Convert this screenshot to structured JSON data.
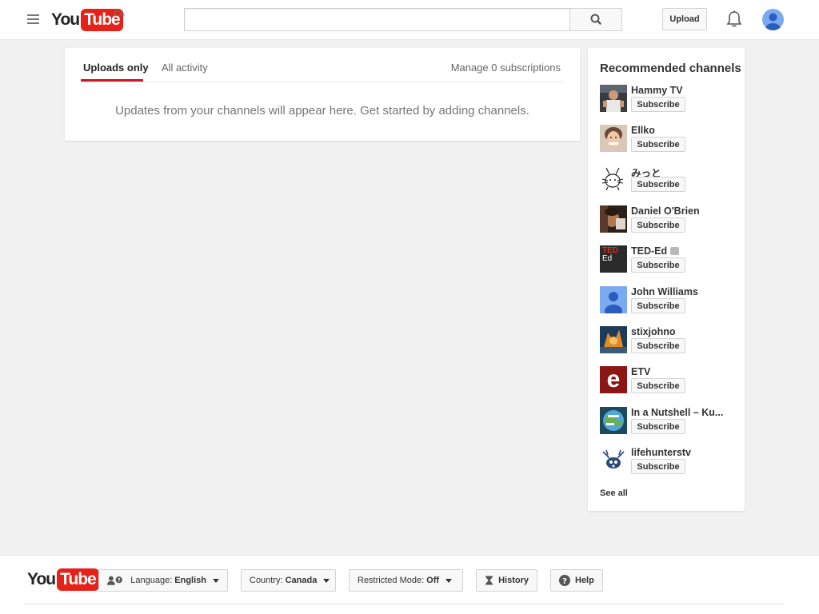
{
  "header": {
    "logo_you": "You",
    "logo_tube": "Tube",
    "country_code": "CA",
    "search_placeholder": "",
    "upload_label": "Upload"
  },
  "feed": {
    "tabs": [
      {
        "label": "Uploads only",
        "active": true
      },
      {
        "label": "All activity",
        "active": false
      }
    ],
    "manage_label": "Manage 0 subscriptions",
    "empty_message": "Updates from your channels will appear here. Get started by adding channels."
  },
  "recommended": {
    "title": "Recommended channels",
    "subscribe_label": "Subscribe",
    "see_all_label": "See all",
    "channels": [
      {
        "name": "Hammy TV",
        "verified": false
      },
      {
        "name": "Ellko",
        "verified": false
      },
      {
        "name": "みっと",
        "verified": false
      },
      {
        "name": "Daniel O'Brien",
        "verified": false
      },
      {
        "name": "TED-Ed",
        "verified": true,
        "thumb_text": "TED Ed"
      },
      {
        "name": "John Williams",
        "verified": false
      },
      {
        "name": "stixjohno",
        "verified": false
      },
      {
        "name": "ETV",
        "verified": false,
        "thumb_text": "e"
      },
      {
        "name": "In a Nutshell – Ku...",
        "verified": false
      },
      {
        "name": "lifehunterstv",
        "verified": false
      }
    ]
  },
  "footer": {
    "language_label": "Language:",
    "language_value": "English",
    "country_label": "Country:",
    "country_value": "Canada",
    "restricted_label": "Restricted Mode:",
    "restricted_value": "Off",
    "history_label": "History",
    "help_label": "Help"
  },
  "colors": {
    "brand_red": "#e62117",
    "tab_underline": "#cc181e",
    "page_bg": "#f1f1f1"
  }
}
